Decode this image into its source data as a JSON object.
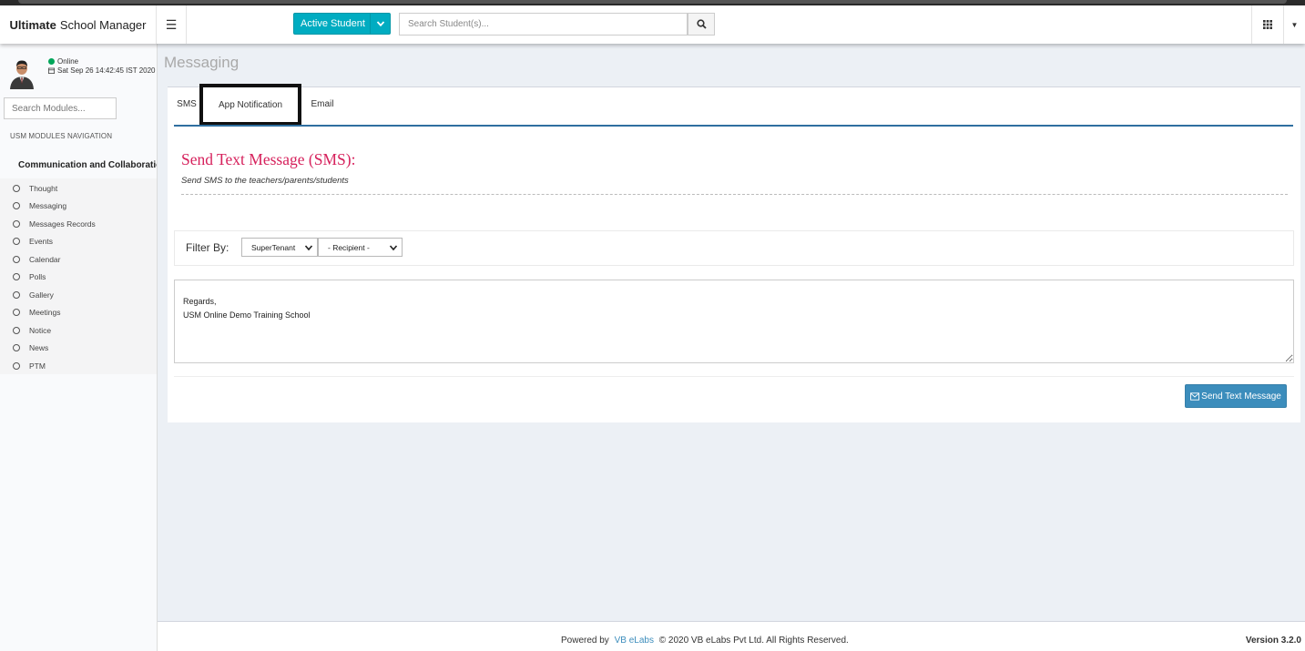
{
  "header": {
    "brand_bold": "Ultimate",
    "brand_rest": "School Manager",
    "active_student_label": "Active Student",
    "student_search_placeholder": "Search Student(s)..."
  },
  "sidebar": {
    "status": "Online",
    "datetime": "Sat Sep 26 14:42:45 IST 2020",
    "search_placeholder": "Search Modules...",
    "nav_header": "USM MODULES NAVIGATION",
    "menu_title": "Communication and Collaboration",
    "items": [
      "Thought",
      "Messaging",
      "Messages Records",
      "Events",
      "Calendar",
      "Polls",
      "Gallery",
      "Meetings",
      "Notice",
      "News",
      "PTM"
    ]
  },
  "page": {
    "title": "Messaging",
    "tabs": [
      "SMS",
      "App Notification",
      "Email"
    ],
    "sms_title": "Send Text Message (SMS):",
    "sms_subtitle": "Send SMS to the teachers/parents/students",
    "filter_label": "Filter By:",
    "tenant_selected": "SuperTenant",
    "recipient_selected": "- Recipient -",
    "message_line1": "Regards,",
    "message_line2": "USM Online Demo Training School",
    "send_label": "Send Text Message"
  },
  "footer": {
    "powered_by": "Powered by",
    "company_link": "VB eLabs",
    "copyright": "© 2020 VB eLabs Pvt Ltd. All Rights Reserved.",
    "version_label": "Version",
    "version": "3.2.0"
  },
  "colors": {
    "accent_teal": "#00acc1",
    "primary_blue": "#3c8dbc",
    "sms_title_red": "#d6215c",
    "online_green": "#00a65a"
  },
  "icons": [
    "menu-icon",
    "search-icon",
    "grid-icon",
    "dashboard-icon",
    "circle-icon",
    "calendar-icon",
    "envelope-icon",
    "chevron-down-icon"
  ]
}
